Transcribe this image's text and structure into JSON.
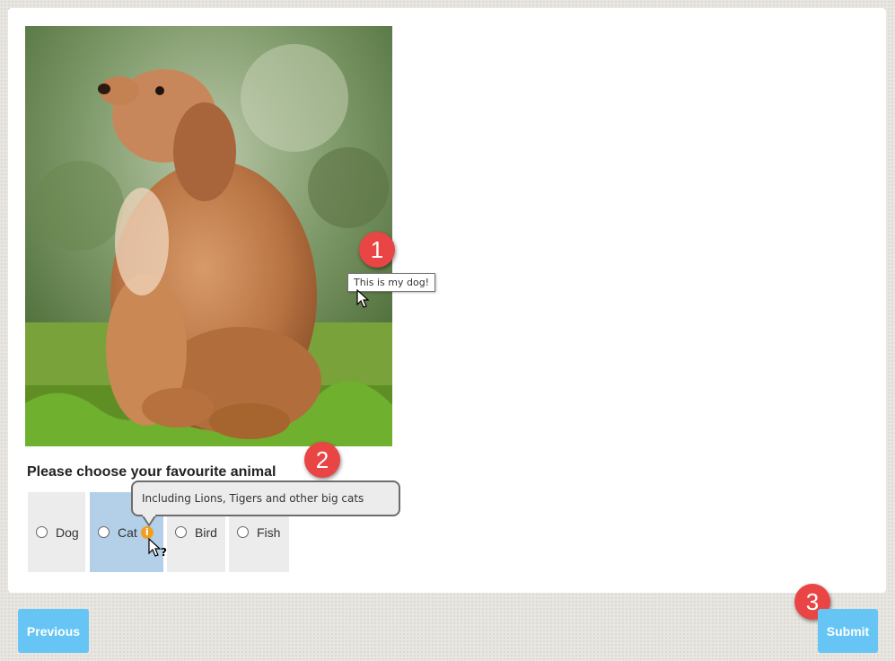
{
  "question": {
    "title": "Please choose your favourite animal"
  },
  "options": [
    {
      "label": "Dog",
      "selected": false
    },
    {
      "label": "Cat",
      "selected": true,
      "has_info": true
    },
    {
      "label": "Bird",
      "selected": false
    },
    {
      "label": "Fish",
      "selected": false
    }
  ],
  "photo_tooltip": "This is my dog!",
  "info_tooltip": "Including Lions, Tigers and other big cats",
  "info_icon_glyph": "i",
  "help_cursor_glyph": "?",
  "navigation": {
    "previous_label": "Previous",
    "submit_label": "Submit"
  },
  "callouts": [
    "1",
    "2",
    "3"
  ],
  "colors": {
    "button": "#66c5f4",
    "selected_option": "#b3d0e8",
    "option": "#ececec",
    "callout": "#e94545",
    "info_icon": "#f0a020"
  },
  "icons": {
    "photo": "dog-photo",
    "info": "info-icon",
    "cursor": "arrow-cursor-icon",
    "help_cursor": "help-cursor-icon"
  }
}
